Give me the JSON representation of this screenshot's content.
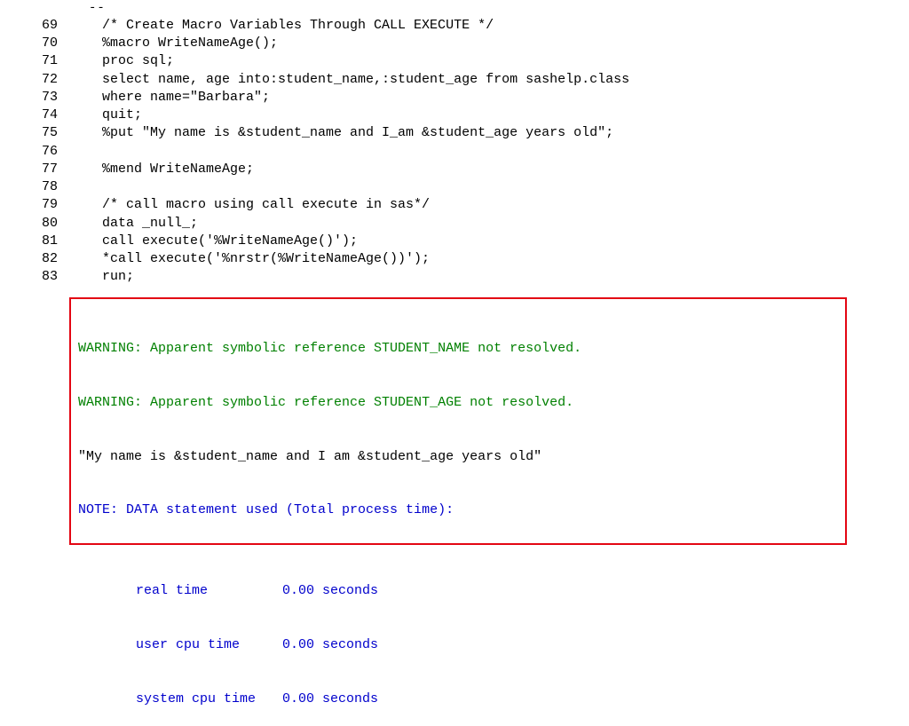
{
  "code_lines": [
    {
      "num": "69",
      "text": "/* Create Macro Variables Through CALL EXECUTE */"
    },
    {
      "num": "70",
      "text": "%macro WriteNameAge();"
    },
    {
      "num": "71",
      "text": "proc sql;"
    },
    {
      "num": "72",
      "text": "select name, age into:student_name,:student_age from sashelp.class"
    },
    {
      "num": "73",
      "text": "where name=\"Barbara\";"
    },
    {
      "num": "74",
      "text": "quit;"
    },
    {
      "num": "75",
      "text": "%put \"My name is &student_name and I_am &student_age years old\";"
    },
    {
      "num": "76",
      "text": ""
    },
    {
      "num": "77",
      "text": "%mend WriteNameAge;"
    },
    {
      "num": "78",
      "text": ""
    },
    {
      "num": "79",
      "text": "/* call macro using call execute in sas*/"
    },
    {
      "num": "80",
      "text": "data _null_;"
    },
    {
      "num": "81",
      "text": "call execute('%WriteNameAge()');"
    },
    {
      "num": "82",
      "text": "*call execute('%nrstr(%WriteNameAge())');"
    },
    {
      "num": "83",
      "text": "run;"
    }
  ],
  "log": {
    "warning1": "WARNING: Apparent symbolic reference STUDENT_NAME not resolved.",
    "warning2": "WARNING: Apparent symbolic reference STUDENT_AGE not resolved.",
    "message": "\"My name is &student_name and I am &student_age years old\"",
    "note": "NOTE: DATA statement used (Total process time):"
  },
  "timing": [
    {
      "label": "real time",
      "value": "0.00 seconds"
    },
    {
      "label": "user cpu time",
      "value": "0.00 seconds"
    },
    {
      "label": "system cpu time",
      "value": "0.00 seconds"
    }
  ],
  "dashes": "--"
}
